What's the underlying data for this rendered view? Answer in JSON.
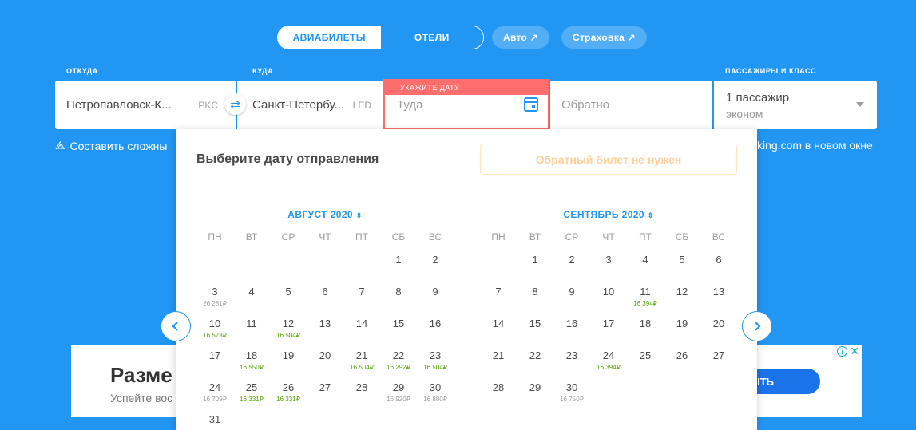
{
  "tabs": {
    "flights": "Авиабилеты",
    "hotels": "Отели"
  },
  "pills": {
    "auto": "Авто ↗",
    "insurance": "Страховка ↗"
  },
  "labels": {
    "from": "Откуда",
    "to": "Куда",
    "passengers": "Пассажиры и класс"
  },
  "form": {
    "origin": "Петропавловск-К...",
    "origin_code": "PKC",
    "destination": "Санкт-Петербу...",
    "destination_code": "LED",
    "date_error": "Укажите дату",
    "date_there_placeholder": "Туда",
    "date_back_placeholder": "Обратно",
    "passengers": "1 пассажир",
    "class": "эконом"
  },
  "links": {
    "complex_route": "Составить сложны",
    "booking": "king.com в новом окне"
  },
  "ad": {
    "headline": "Разме",
    "sub": "Успейте вос",
    "button": "ЫТЬ",
    "info": "i",
    "close": "✕"
  },
  "calendar": {
    "title": "Выберите дату отправления",
    "oneway": "Обратный билет не нужен",
    "weekdays": [
      "ПН",
      "ВТ",
      "СР",
      "ЧТ",
      "ПТ",
      "СБ",
      "ВС"
    ],
    "months": [
      {
        "name": "Август 2020",
        "sorter": "⇕",
        "first_col": 5,
        "days": [
          {
            "d": "1"
          },
          {
            "d": "2"
          },
          {
            "d": "3",
            "p": "26 281₽"
          },
          {
            "d": "4"
          },
          {
            "d": "5"
          },
          {
            "d": "6"
          },
          {
            "d": "7"
          },
          {
            "d": "8"
          },
          {
            "d": "9"
          },
          {
            "d": "10",
            "p": "16 573₽",
            "c": true
          },
          {
            "d": "11"
          },
          {
            "d": "12",
            "p": "16 504₽",
            "c": true
          },
          {
            "d": "13"
          },
          {
            "d": "14"
          },
          {
            "d": "15"
          },
          {
            "d": "16"
          },
          {
            "d": "17"
          },
          {
            "d": "18",
            "p": "16 550₽",
            "c": true
          },
          {
            "d": "19"
          },
          {
            "d": "20"
          },
          {
            "d": "21",
            "p": "16 504₽",
            "c": true
          },
          {
            "d": "22",
            "p": "16 292₽",
            "c": true
          },
          {
            "d": "23",
            "p": "16 504₽",
            "c": true
          },
          {
            "d": "24",
            "p": "16 709₽"
          },
          {
            "d": "25",
            "p": "16 331₽",
            "c": true
          },
          {
            "d": "26",
            "p": "16 331₽",
            "c": true
          },
          {
            "d": "27"
          },
          {
            "d": "28"
          },
          {
            "d": "29",
            "p": "16 920₽"
          },
          {
            "d": "30",
            "p": "16 880₽"
          },
          {
            "d": "31"
          }
        ]
      },
      {
        "name": "Сентябрь 2020",
        "sorter": "⇕",
        "first_col": 1,
        "days": [
          {
            "d": "1"
          },
          {
            "d": "2"
          },
          {
            "d": "3"
          },
          {
            "d": "4"
          },
          {
            "d": "5"
          },
          {
            "d": "6"
          },
          {
            "d": "7"
          },
          {
            "d": "8"
          },
          {
            "d": "9"
          },
          {
            "d": "10"
          },
          {
            "d": "11",
            "p": "16 394₽",
            "c": true
          },
          {
            "d": "12"
          },
          {
            "d": "13"
          },
          {
            "d": "14"
          },
          {
            "d": "15"
          },
          {
            "d": "16"
          },
          {
            "d": "17"
          },
          {
            "d": "18"
          },
          {
            "d": "19"
          },
          {
            "d": "20"
          },
          {
            "d": "21"
          },
          {
            "d": "22"
          },
          {
            "d": "23"
          },
          {
            "d": "24",
            "p": "16 394₽",
            "c": true
          },
          {
            "d": "25"
          },
          {
            "d": "26"
          },
          {
            "d": "27"
          },
          {
            "d": "28"
          },
          {
            "d": "29"
          },
          {
            "d": "30",
            "p": "16 750₽"
          }
        ]
      }
    ]
  }
}
